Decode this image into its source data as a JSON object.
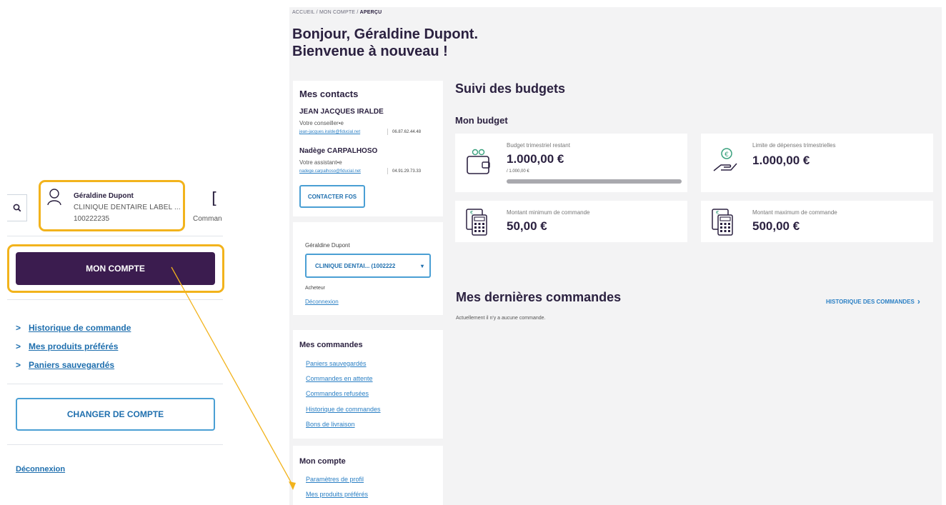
{
  "left_panel": {
    "user": {
      "name": "Géraldine Dupont",
      "company": "CLINIQUE DENTAIRE LABEL ...",
      "id": "100222235"
    },
    "commands_label": "Comman",
    "account_button": "MON COMPTE",
    "links": [
      {
        "label": "Historique de commande"
      },
      {
        "label": "Mes produits préférés"
      },
      {
        "label": "Paniers sauvegardés"
      }
    ],
    "switch_account_button": "CHANGER DE COMPTE",
    "logout": "Déconnexion"
  },
  "main": {
    "breadcrumb": {
      "home": "ACCUEIL",
      "account": "MON COMPTE",
      "current": "APERÇU",
      "sep": "/"
    },
    "greeting_line1": "Bonjour, Géraldine Dupont.",
    "greeting_line2": "Bienvenue à nouveau !",
    "contacts": {
      "title": "Mes contacts",
      "people": [
        {
          "name": "JEAN JACQUES IRALDE",
          "role": "Votre conseiller•e",
          "email": "jean-jacques.iralde@fiducial.net",
          "phone": "06.87.62.44.48"
        },
        {
          "name": "Nadège CARPALHOSO",
          "role": "Votre assistant•e",
          "email": "nadege.carpalhoso@fiducial.net",
          "phone": "04.91.29.73.33"
        }
      ],
      "contact_button": "CONTACTER FOS"
    },
    "account_switch": {
      "user": "Géraldine Dupont",
      "selected_account": "CLINIQUE DENTAI... (1002222",
      "role": "Acheteur",
      "logout": "Déconnexion"
    },
    "orders_nav": {
      "title": "Mes commandes",
      "links": [
        "Paniers sauvegardés",
        "Commandes en attente",
        "Commandes refusées",
        "Historique de commandes",
        "Bons de livraison"
      ]
    },
    "account_nav": {
      "title": "Mon compte",
      "links": [
        "Paramètres de profil",
        "Mes produits préférés"
      ]
    },
    "budgets": {
      "title": "Suivi des budgets",
      "subtitle": "Mon budget",
      "cards": [
        {
          "label": "Budget trimestriel restant",
          "value": "1.000,00 €",
          "sub": "/ 1.000,00 €",
          "progress_remaining_fraction": 1.0,
          "icon": "wallet-icon"
        },
        {
          "label": "Limite de dépenses trimestrielles",
          "value": "1.000,00 €",
          "icon": "hand-coin-icon"
        },
        {
          "label": "Montant minimum de commande",
          "value": "50,00 €",
          "icon": "calculator-icon"
        },
        {
          "label": "Montant maximum de commande",
          "value": "500,00 €",
          "icon": "calculator-icon"
        }
      ]
    },
    "recent_orders": {
      "title": "Mes dernières commandes",
      "history_link": "HISTORIQUE DES COMMANDES",
      "empty_text": "Actuellement il n'y a aucune commande."
    }
  },
  "colors": {
    "primary_dark": "#3b1c4f",
    "highlight": "#f2b31c",
    "link_blue": "#2a7fc4",
    "button_border": "#4a9fd4",
    "background": "#f3f3f4"
  }
}
